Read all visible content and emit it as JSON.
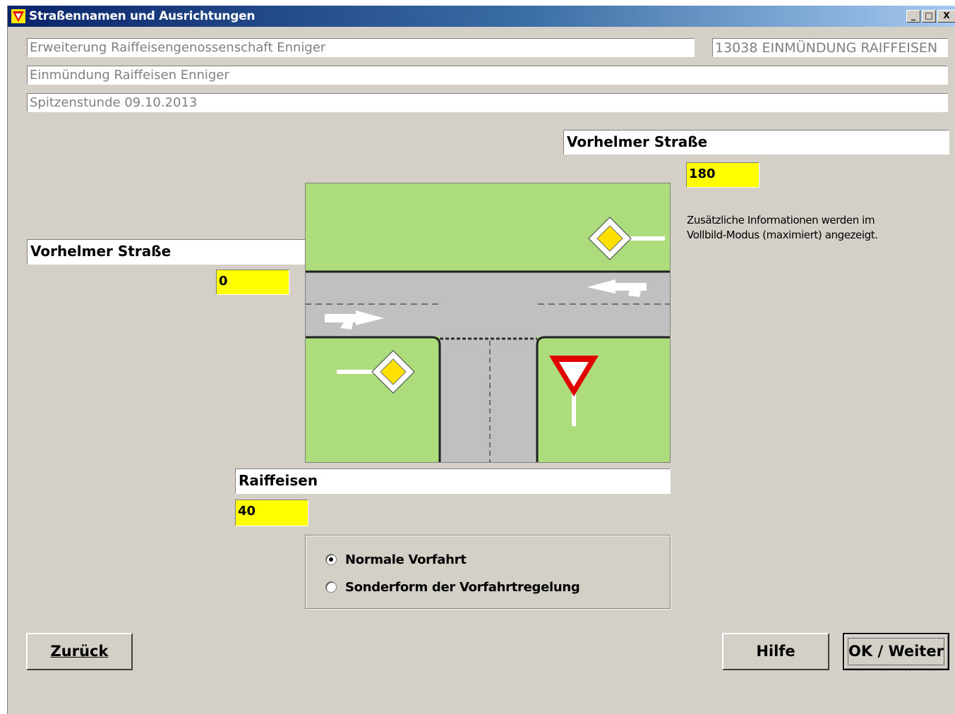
{
  "window": {
    "title": "Straßennamen und Ausrichtungen",
    "controls": {
      "minimize": "_",
      "maximize": "□",
      "close": "X"
    }
  },
  "header": {
    "project": "Erweiterung Raiffeisengenossenschaft Enniger",
    "node_code": "13038 EINMÜNDUNG RAIFFEISEN",
    "intersection": "Einmündung Raiffeisen Enniger",
    "period": "Spitzenstunde 09.10.2013"
  },
  "arms": {
    "east": {
      "name": "Vorhelmer Straße",
      "angle": "180"
    },
    "west": {
      "name": "Vorhelmer Straße",
      "angle": "0"
    },
    "south": {
      "name": "Raiffeisen",
      "angle": "40"
    }
  },
  "info_text": "Zusätzliche Informationen werden im Vollbild-Modus (maximiert) angezeigt.",
  "diagram_icons": [
    "priority-road-sign-icon",
    "yield-sign-icon",
    "lane-arrow-icon"
  ],
  "right_of_way": {
    "options": [
      {
        "label": "Normale Vorfahrt",
        "selected": true
      },
      {
        "label": "Sonderform der Vorfahrtregelung",
        "selected": false
      }
    ]
  },
  "buttons": {
    "back": "Zurück",
    "help": "Hilfe",
    "ok": "OK / Weiter"
  },
  "colors": {
    "grass": "#acdc7c",
    "road": "#c0c0c0",
    "highlight": "#ffff00",
    "titlebar": "#0a246a"
  }
}
